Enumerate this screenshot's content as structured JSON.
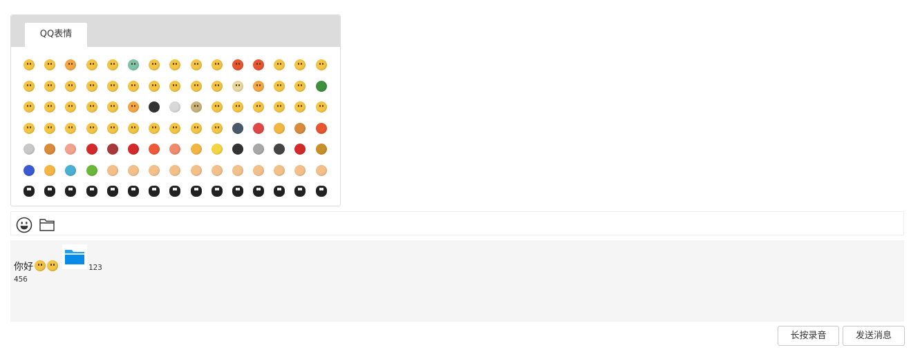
{
  "emoji_panel": {
    "tab_label": "QQ表情",
    "rows": [
      [
        {
          "icon": "smile-face",
          "color": "#f4c542"
        },
        {
          "icon": "shy-face",
          "color": "#f4c542"
        },
        {
          "icon": "heart-eyes-face",
          "color": "#f4a742"
        },
        {
          "icon": "surprised-face",
          "color": "#f4c542"
        },
        {
          "icon": "sunglasses-face",
          "color": "#f4c542"
        },
        {
          "icon": "crying-face",
          "color": "#7cc4a8"
        },
        {
          "icon": "shy-blush-face",
          "color": "#f4c542"
        },
        {
          "icon": "silent-face",
          "color": "#f4c542"
        },
        {
          "icon": "sleepy-face",
          "color": "#f4c542"
        },
        {
          "icon": "cry-face",
          "color": "#f4c542"
        },
        {
          "icon": "angry-red-face",
          "color": "#e8552f"
        },
        {
          "icon": "furious-face",
          "color": "#e8552f"
        },
        {
          "icon": "tongue-face",
          "color": "#f4c542"
        },
        {
          "icon": "grin-face",
          "color": "#f4c542"
        },
        {
          "icon": "amazed-face",
          "color": "#f4c542"
        }
      ],
      [
        {
          "icon": "sad-face",
          "color": "#f4c542"
        },
        {
          "icon": "cool-face",
          "color": "#f4c542"
        },
        {
          "icon": "sweat-face",
          "color": "#f4c542"
        },
        {
          "icon": "scream-face",
          "color": "#f4c542"
        },
        {
          "icon": "dizzy-face",
          "color": "#f4c542"
        },
        {
          "icon": "cover-mouth-face",
          "color": "#f4c542"
        },
        {
          "icon": "cheeky-face",
          "color": "#f4c542"
        },
        {
          "icon": "nervous-face",
          "color": "#f4c542"
        },
        {
          "icon": "puzzled-face",
          "color": "#f4c542"
        },
        {
          "icon": "unhappy-face",
          "color": "#f4c542"
        },
        {
          "icon": "blank-face",
          "color": "#e8d9a0"
        },
        {
          "icon": "fearful-face",
          "color": "#f4a742"
        },
        {
          "icon": "wink-face",
          "color": "#f4c542"
        },
        {
          "icon": "laugh-face",
          "color": "#f4c542"
        },
        {
          "icon": "turtle-icon",
          "color": "#3e8f3e"
        }
      ],
      [
        {
          "icon": "headband-face",
          "color": "#f4c542"
        },
        {
          "icon": "drool-face",
          "color": "#f4c542"
        },
        {
          "icon": "struggle-face",
          "color": "#f4c542"
        },
        {
          "icon": "shh-face",
          "color": "#f4c542"
        },
        {
          "icon": "spiral-eyes-face",
          "color": "#f4c542"
        },
        {
          "icon": "distressed-face",
          "color": "#f4a742"
        },
        {
          "icon": "panda-icon",
          "color": "#333333"
        },
        {
          "icon": "skull-icon",
          "color": "#d8d8d8"
        },
        {
          "icon": "hammer-face",
          "color": "#c9b37a"
        },
        {
          "icon": "bye-face",
          "color": "#f4c542"
        },
        {
          "icon": "sweat-wipe-face",
          "color": "#f4c542"
        },
        {
          "icon": "pick-nose-face",
          "color": "#f4c542"
        },
        {
          "icon": "clap-face",
          "color": "#f4c542"
        },
        {
          "icon": "embarrassed-face",
          "color": "#f4c542"
        },
        {
          "icon": "snicker-face",
          "color": "#f4c542"
        }
      ],
      [
        {
          "icon": "left-hum-face",
          "color": "#f4c542"
        },
        {
          "icon": "right-hum-face",
          "color": "#f4c542"
        },
        {
          "icon": "yawn-face",
          "color": "#f4c542"
        },
        {
          "icon": "disdain-face",
          "color": "#f4c542"
        },
        {
          "icon": "wronged-face",
          "color": "#f4c542"
        },
        {
          "icon": "about-to-cry-face",
          "color": "#f4c542"
        },
        {
          "icon": "sly-face",
          "color": "#f4c542"
        },
        {
          "icon": "kiss-face",
          "color": "#f4c542"
        },
        {
          "icon": "scared-face",
          "color": "#f4c542"
        },
        {
          "icon": "pitiful-face",
          "color": "#f4c542"
        },
        {
          "icon": "kitchen-knife-icon",
          "color": "#4a5a6a"
        },
        {
          "icon": "watermelon-icon",
          "color": "#e04848"
        },
        {
          "icon": "beer-icon",
          "color": "#f4b642"
        },
        {
          "icon": "basketball-icon",
          "color": "#d98a3a"
        },
        {
          "icon": "ping-pong-icon",
          "color": "#e8552f"
        }
      ],
      [
        {
          "icon": "coffee-icon",
          "color": "#c8c8c8"
        },
        {
          "icon": "rice-bowl-icon",
          "color": "#d98a3a"
        },
        {
          "icon": "pig-head-icon",
          "color": "#f2a38c"
        },
        {
          "icon": "rose-icon",
          "color": "#d42a2a"
        },
        {
          "icon": "wilted-flower-icon",
          "color": "#a83a3a"
        },
        {
          "icon": "lips-icon",
          "color": "#d42a2a"
        },
        {
          "icon": "heart-icon",
          "color": "#f05a3a"
        },
        {
          "icon": "broken-heart-icon",
          "color": "#f08a6a"
        },
        {
          "icon": "cake-icon",
          "color": "#f4b642"
        },
        {
          "icon": "lightning-icon",
          "color": "#f4d442"
        },
        {
          "icon": "bomb-icon",
          "color": "#333333"
        },
        {
          "icon": "dagger-icon",
          "color": "#a8a8a8"
        },
        {
          "icon": "soccer-icon",
          "color": "#444444"
        },
        {
          "icon": "ladybug-icon",
          "color": "#d42a2a"
        },
        {
          "icon": "poop-icon",
          "color": "#c8902a"
        }
      ],
      [
        {
          "icon": "moon-icon",
          "color": "#3a5ad4"
        },
        {
          "icon": "sun-icon",
          "color": "#f4b642"
        },
        {
          "icon": "gift-icon",
          "color": "#4ab0d4"
        },
        {
          "icon": "hug-icon",
          "color": "#6ab83a"
        },
        {
          "icon": "thumbs-up-icon",
          "color": "#f4c08a"
        },
        {
          "icon": "thumbs-down-icon",
          "color": "#f4c08a"
        },
        {
          "icon": "handshake-icon",
          "color": "#f4c08a"
        },
        {
          "icon": "victory-hand-icon",
          "color": "#f4c08a"
        },
        {
          "icon": "fist-salute-icon",
          "color": "#f4c08a"
        },
        {
          "icon": "beckon-icon",
          "color": "#f4c08a"
        },
        {
          "icon": "fist-icon",
          "color": "#f4c08a"
        },
        {
          "icon": "pinky-icon",
          "color": "#f4c08a"
        },
        {
          "icon": "rock-hand-icon",
          "color": "#f4c08a"
        },
        {
          "icon": "no-hand-icon",
          "color": "#f4c08a"
        },
        {
          "icon": "ok-hand-icon",
          "color": "#f4c08a"
        }
      ],
      [
        {
          "icon": "penguin-love-icon",
          "color": "#222222"
        },
        {
          "icon": "penguin-kiss-icon",
          "color": "#222222"
        },
        {
          "icon": "penguin-jump-icon",
          "color": "#222222"
        },
        {
          "icon": "penguin-shiver-icon",
          "color": "#222222"
        },
        {
          "icon": "penguin-fire-icon",
          "color": "#222222"
        },
        {
          "icon": "penguin-spin-icon",
          "color": "#222222"
        },
        {
          "icon": "penguin-kowtow-icon",
          "color": "#222222"
        },
        {
          "icon": "penguin-turn-icon",
          "color": "#222222"
        },
        {
          "icon": "penguin-excited-icon",
          "color": "#222222"
        },
        {
          "icon": "penguin-dance-icon",
          "color": "#222222"
        },
        {
          "icon": "penguin-kiss2-icon",
          "color": "#222222"
        },
        {
          "icon": "penguin-taichi-left-icon",
          "color": "#222222"
        },
        {
          "icon": "penguin-taichi-right-icon",
          "color": "#222222"
        },
        {
          "icon": "penguin-wave-icon",
          "color": "#222222"
        },
        {
          "icon": "penguin-bow-icon",
          "color": "#222222"
        }
      ]
    ]
  },
  "toolbar": {
    "emoji_icon": "smiley-icon",
    "file_icon": "folder-icon"
  },
  "message": {
    "text_greeting": "你好",
    "face_1": "smile-face",
    "face_2": "smile-face",
    "file_icon": "blue-folder-icon",
    "file_name": "123",
    "line2": "456"
  },
  "buttons": {
    "record_label": "长按录音",
    "send_label": "发送消息"
  },
  "colors": {
    "panel_header": "#dcdcdc",
    "message_bg": "#f5f5f5",
    "folder_blue": "#1e9ff2"
  }
}
